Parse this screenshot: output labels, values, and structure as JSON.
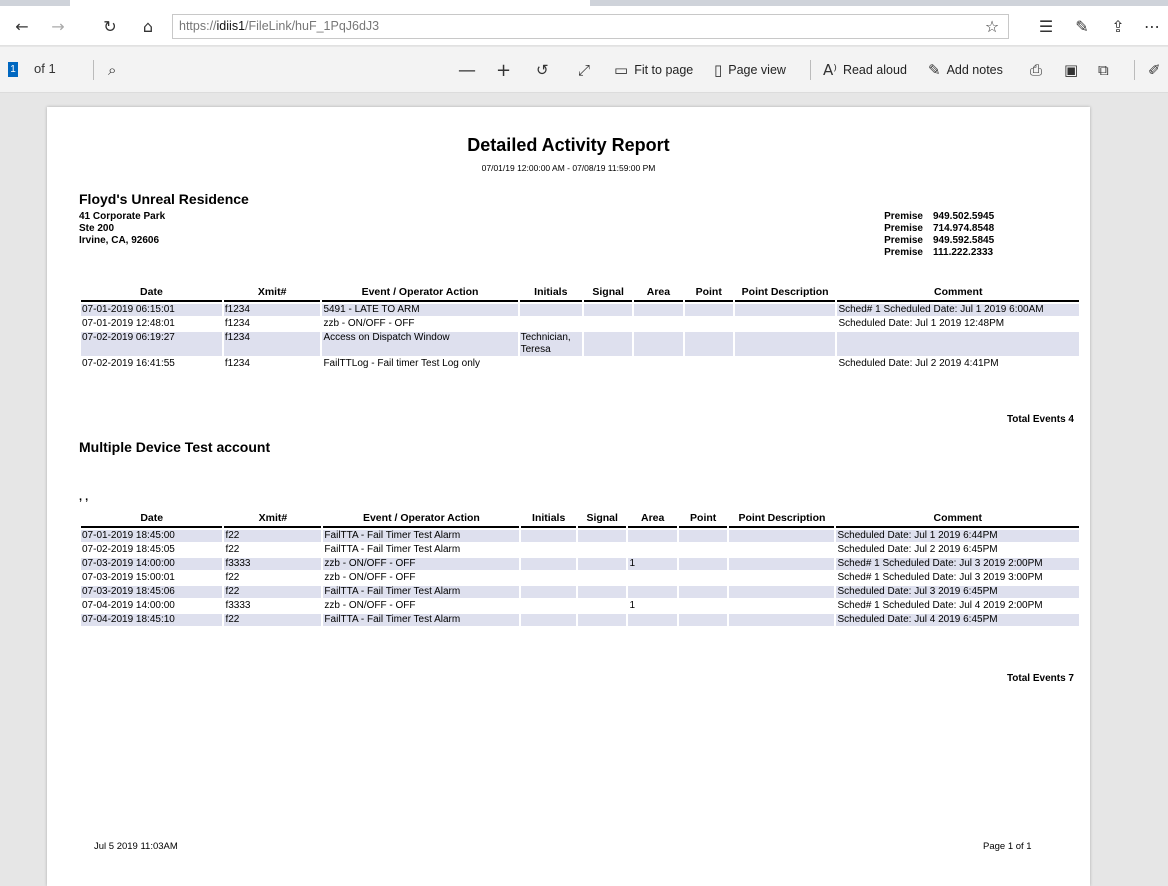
{
  "browser": {
    "url_host": "idiis1",
    "url_rest": "/FileLink/huF_1PqJ6dJ3",
    "url_scheme": "https://"
  },
  "pdf_toolbar": {
    "page_current": "1",
    "page_total": "of 1",
    "fit_to_page": "Fit to page",
    "page_view": "Page view",
    "read_aloud": "Read aloud",
    "add_notes": "Add notes"
  },
  "report": {
    "title": "Detailed Activity Report",
    "date_range": "07/01/19 12:00:00 AM - 07/08/19 11:59:00 PM",
    "columns": [
      "Date",
      "Xmit#",
      "Event / Operator Action",
      "Initials",
      "Signal",
      "Area",
      "Point",
      "Point Description",
      "Comment"
    ],
    "accounts": [
      {
        "name": "Floyd's Unreal Residence",
        "address": [
          "41 Corporate Park",
          "Ste 200",
          "Irvine, CA, 92606"
        ],
        "phones": [
          {
            "label": "Premise",
            "number": "949.502.5945"
          },
          {
            "label": "Premise",
            "number": "714.974.8548"
          },
          {
            "label": "Premise",
            "number": "949.592.5845"
          },
          {
            "label": "Premise",
            "number": "111.222.2333"
          }
        ],
        "rows": [
          {
            "date": "07-01-2019 06:15:01",
            "xmit": "f1234",
            "event": "5491 - LATE TO ARM",
            "initials": "",
            "signal": "",
            "area": "",
            "point": "",
            "point_desc": "",
            "comment": "Sched# 1 Scheduled Date: Jul 1 2019 6:00AM"
          },
          {
            "date": "07-01-2019 12:48:01",
            "xmit": "f1234",
            "event": "zzb - ON/OFF - OFF",
            "initials": "",
            "signal": "",
            "area": "",
            "point": "",
            "point_desc": "",
            "comment": "Scheduled Date: Jul 1 2019 12:48PM"
          },
          {
            "date": "07-02-2019 06:19:27",
            "xmit": "f1234",
            "event": "Access on Dispatch Window",
            "initials": "Technician, Teresa",
            "signal": "",
            "area": "",
            "point": "",
            "point_desc": "",
            "comment": ""
          },
          {
            "date": "07-02-2019 16:41:55",
            "xmit": "f1234",
            "event": "FailTTLog - Fail timer Test Log only",
            "initials": "",
            "signal": "",
            "area": "",
            "point": "",
            "point_desc": "",
            "comment": "Scheduled Date: Jul 2 2019 4:41PM"
          }
        ],
        "total": "Total Events 4"
      },
      {
        "name": "Multiple Device Test account",
        "address_line": ", ,",
        "rows": [
          {
            "date": "07-01-2019 18:45:00",
            "xmit": "f22",
            "event": "FailTTA - Fail Timer Test Alarm",
            "initials": "",
            "signal": "",
            "area": "",
            "point": "",
            "point_desc": "",
            "comment": "Scheduled Date: Jul 1 2019 6:44PM"
          },
          {
            "date": "07-02-2019 18:45:05",
            "xmit": "f22",
            "event": "FailTTA - Fail Timer Test Alarm",
            "initials": "",
            "signal": "",
            "area": "",
            "point": "",
            "point_desc": "",
            "comment": "Scheduled Date: Jul 2 2019 6:45PM"
          },
          {
            "date": "07-03-2019 14:00:00",
            "xmit": "f3333",
            "event": "zzb - ON/OFF - OFF",
            "initials": "",
            "signal": "",
            "area": "1",
            "point": "",
            "point_desc": "",
            "comment": "Sched# 1 Scheduled Date: Jul 3 2019 2:00PM"
          },
          {
            "date": "07-03-2019 15:00:01",
            "xmit": "f22",
            "event": "zzb - ON/OFF - OFF",
            "initials": "",
            "signal": "",
            "area": "",
            "point": "",
            "point_desc": "",
            "comment": "Sched# 1 Scheduled Date: Jul 3 2019 3:00PM"
          },
          {
            "date": "07-03-2019 18:45:06",
            "xmit": "f22",
            "event": "FailTTA - Fail Timer Test Alarm",
            "initials": "",
            "signal": "",
            "area": "",
            "point": "",
            "point_desc": "",
            "comment": "Scheduled Date: Jul 3 2019 6:45PM"
          },
          {
            "date": "07-04-2019 14:00:00",
            "xmit": "f3333",
            "event": "zzb - ON/OFF - OFF",
            "initials": "",
            "signal": "",
            "area": "1",
            "point": "",
            "point_desc": "",
            "comment": "Sched# 1 Scheduled Date: Jul 4 2019 2:00PM"
          },
          {
            "date": "07-04-2019 18:45:10",
            "xmit": "f22",
            "event": "FailTTA - Fail Timer Test Alarm",
            "initials": "",
            "signal": "",
            "area": "",
            "point": "",
            "point_desc": "",
            "comment": "Scheduled Date: Jul 4 2019 6:45PM"
          }
        ],
        "total": "Total Events 7"
      }
    ],
    "footer": {
      "printed": "Jul 5 2019 11:03AM",
      "page": "Page 1 of 1"
    }
  }
}
